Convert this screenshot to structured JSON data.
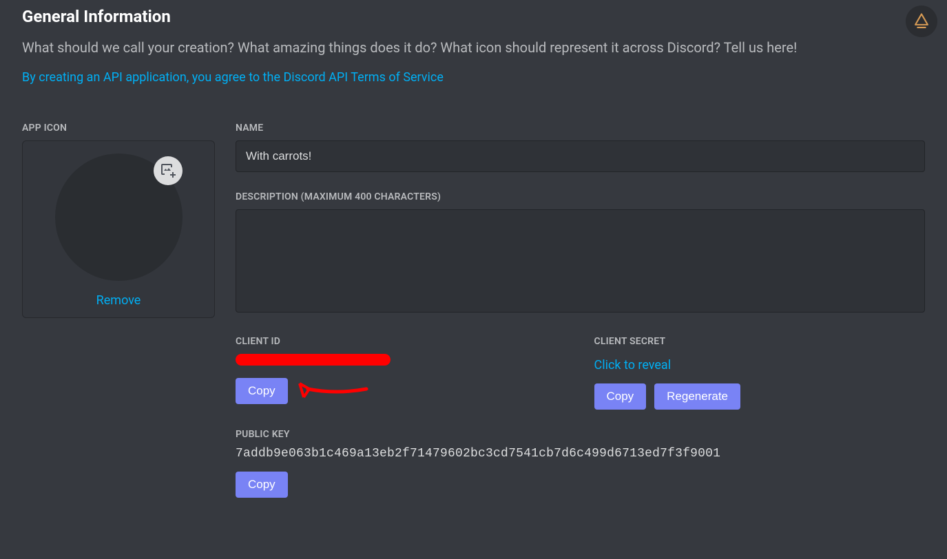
{
  "header": {
    "title": "General Information",
    "intro": "What should we call your creation? What amazing things does it do? What icon should represent it across Discord? Tell us here!",
    "tos_link": "By creating an API application, you agree to the Discord API Terms of Service"
  },
  "appicon": {
    "label": "APP ICON",
    "remove": "Remove"
  },
  "name": {
    "label": "NAME",
    "value": "With carrots!"
  },
  "description": {
    "label": "DESCRIPTION (MAXIMUM 400 CHARACTERS)",
    "value": ""
  },
  "client_id": {
    "label": "CLIENT ID",
    "copy": "Copy"
  },
  "client_secret": {
    "label": "CLIENT SECRET",
    "reveal": "Click to reveal",
    "copy": "Copy",
    "regenerate": "Regenerate"
  },
  "public_key": {
    "label": "PUBLIC KEY",
    "value": "7addb9e063b1c469a13eb2f71479602bc3cd7541cb7d6c499d6713ed7f3f9001",
    "copy": "Copy"
  }
}
